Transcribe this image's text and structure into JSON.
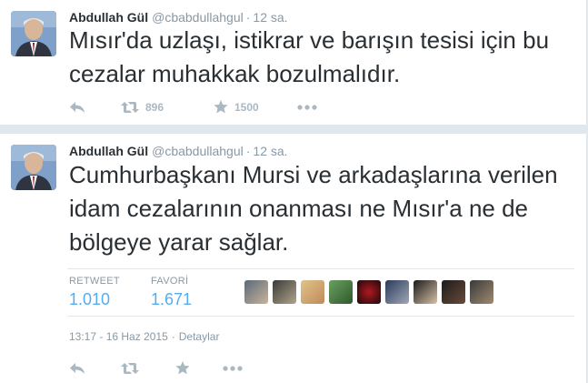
{
  "tweets": [
    {
      "name": "Abdullah Gül",
      "handle": "@cbabdullahgul",
      "time": "12 sa.",
      "text": "Mısır'da uzlaşı, istikrar ve barışın tesisi için bu cezalar muhakkak bozulmalıdır.",
      "retweets": "896",
      "favorites": "1500"
    },
    {
      "name": "Abdullah Gül",
      "handle": "@cbabdullahgul",
      "time": "12 sa.",
      "text": "Cumhurbaşkanı Mursi ve arkadaşlarına verilen idam cezalarının onanması ne Mısır'a ne de bölgeye yarar sağlar.",
      "stats": {
        "retweet_label": "RETWEET",
        "retweet_value": "1.010",
        "favorite_label": "FAVORİ",
        "favorite_value": "1.671"
      },
      "timestamp": "13:17 - 16 Haz 2015",
      "separator": "·",
      "details_link": "Detaylar"
    }
  ],
  "colors": {
    "accent": "#55acee",
    "muted": "#8899a6",
    "icon": "#aab8c2",
    "text": "#292f33"
  }
}
